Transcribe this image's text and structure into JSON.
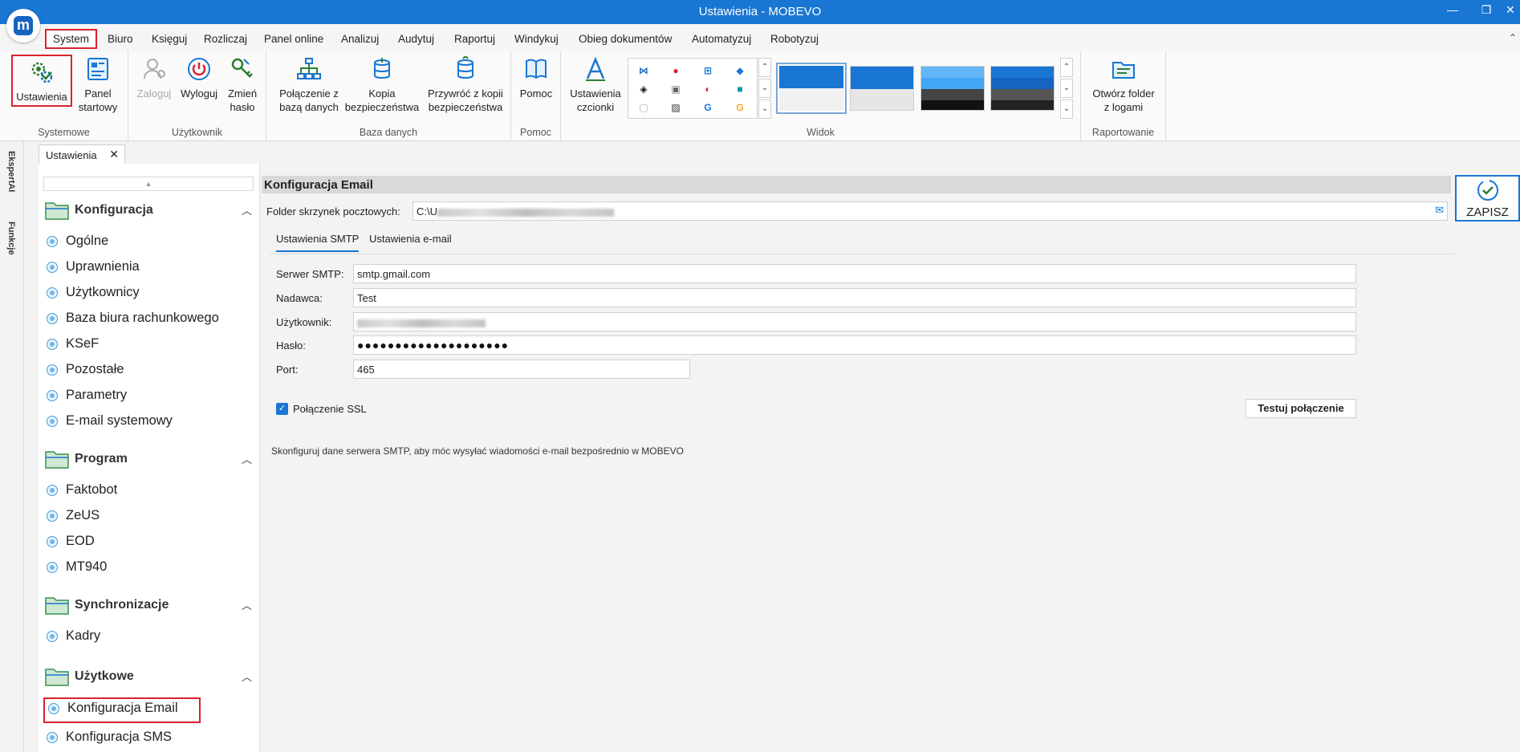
{
  "window": {
    "title": "Ustawienia - MOBEVO"
  },
  "menu": {
    "items": [
      "System",
      "Biuro",
      "Księguj",
      "Rozliczaj",
      "Panel online",
      "Analizuj",
      "Audytuj",
      "Raportuj",
      "Windykuj",
      "Obieg dokumentów",
      "Automatyzuj",
      "Robotyzuj"
    ],
    "active": "System"
  },
  "ribbon": {
    "systemowe": {
      "label": "Systemowe",
      "ustawienia": "Ustawienia",
      "panel_l1": "Panel",
      "panel_l2": "startowy"
    },
    "uzytkownik": {
      "label": "Użytkownik",
      "zaloguj": "Zaloguj",
      "wyloguj": "Wyloguj",
      "zmien_l1": "Zmień",
      "zmien_l2": "hasło"
    },
    "baza": {
      "label": "Baza danych",
      "polaczenie_l1": "Połączenie z",
      "polaczenie_l2": "bazą danych",
      "kopia_l1": "Kopia",
      "kopia_l2": "bezpieczeństwa",
      "przywroc_l1": "Przywróć z kopii",
      "przywroc_l2": "bezpieczeństwa"
    },
    "pomoc": {
      "label": "Pomoc",
      "pomoc": "Pomoc"
    },
    "widok": {
      "label": "Widok",
      "czcionki_l1": "Ustawienia",
      "czcionki_l2": "czcionki"
    },
    "raportowanie": {
      "label": "Raportowanie",
      "folder_l1": "Otwórz folder",
      "folder_l2": "z logami"
    }
  },
  "side_strip": {
    "ekspert": "EkspertAI",
    "funkcje": "Funkcje"
  },
  "doc_tab": {
    "label": "Ustawienia",
    "close": "✕"
  },
  "sidebar": {
    "sections": [
      {
        "title": "Konfiguracja",
        "items": [
          "Ogólne",
          "Uprawnienia",
          "Użytkownicy",
          "Baza biura rachunkowego",
          "KSeF",
          "Pozostałe",
          "Parametry",
          "E-mail systemowy"
        ]
      },
      {
        "title": "Program",
        "items": [
          "Faktobot",
          "ZeUS",
          "EOD",
          "MT940"
        ]
      },
      {
        "title": "Synchronizacje",
        "items": [
          "Kadry"
        ]
      },
      {
        "title": "Użytkowe",
        "items": [
          "Konfiguracja Email",
          "Konfiguracja SMS"
        ]
      }
    ],
    "selected": "Konfiguracja Email"
  },
  "content": {
    "section_title": "Konfiguracja Email",
    "folder_label": "Folder skrzynek pocztowych:",
    "folder_value": "C:\\U",
    "tabs": [
      "Ustawienia SMTP",
      "Ustawienia e-mail"
    ],
    "active_tab": "Ustawienia SMTP",
    "fields": {
      "server_label": "Serwer SMTP:",
      "server_value": "smtp.gmail.com",
      "sender_label": "Nadawca:",
      "sender_value": "Test",
      "user_label": "Użytkownik:",
      "password_label": "Hasło:",
      "password_value": "●●●●●●●●●●●●●●●●●●●●",
      "port_label": "Port:",
      "port_value": "465"
    },
    "ssl_label": "Połączenie SSL",
    "ssl_checked": true,
    "test_button": "Testuj połączenie",
    "hint": "Skonfiguruj dane serwera SMTP, aby móc wysyłać wiadomości e-mail bezpośrednio w MOBEVO"
  },
  "save_button": "ZAPISZ",
  "colors": {
    "accent": "#1976d2",
    "highlight": "#d9232e",
    "titlebar": "#1976d2"
  }
}
